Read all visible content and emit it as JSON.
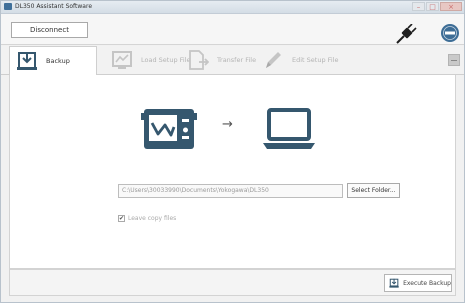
{
  "window": {
    "title": "DL350 Assistant Software",
    "minimize_glyph": "–",
    "maximize_glyph": "□",
    "close_glyph": "×"
  },
  "toolbar": {
    "disconnect_label": "Disconnect",
    "plug_icon": "plug-icon",
    "info_icon": "info-icon"
  },
  "tabs": [
    {
      "label": "Backup",
      "icon": "backup-icon",
      "state": "active"
    },
    {
      "label": "Load Setup File",
      "icon": "load-setup-icon",
      "state": "disabled"
    },
    {
      "label": "Transfer File",
      "icon": "transfer-file-icon",
      "state": "disabled"
    },
    {
      "label": "Edit Setup File",
      "icon": "edit-setup-icon",
      "state": "disabled"
    }
  ],
  "main": {
    "arrow_glyph": "→",
    "folder_path": "C:\\Users\\30033990\\Documents\\Yokogawa\\DL350",
    "select_folder_label": "Select Folder...",
    "leave_copy_checked": true,
    "check_glyph": "✔",
    "leave_copy_label": "Leave copy files"
  },
  "footer": {
    "execute_label": "Execute Backup"
  },
  "colors": {
    "icon_dark": "#35576e",
    "icon_disabled": "#c5c5c5",
    "plug_dark": "#1e1e1e",
    "info_blue": "#3d6d96"
  }
}
